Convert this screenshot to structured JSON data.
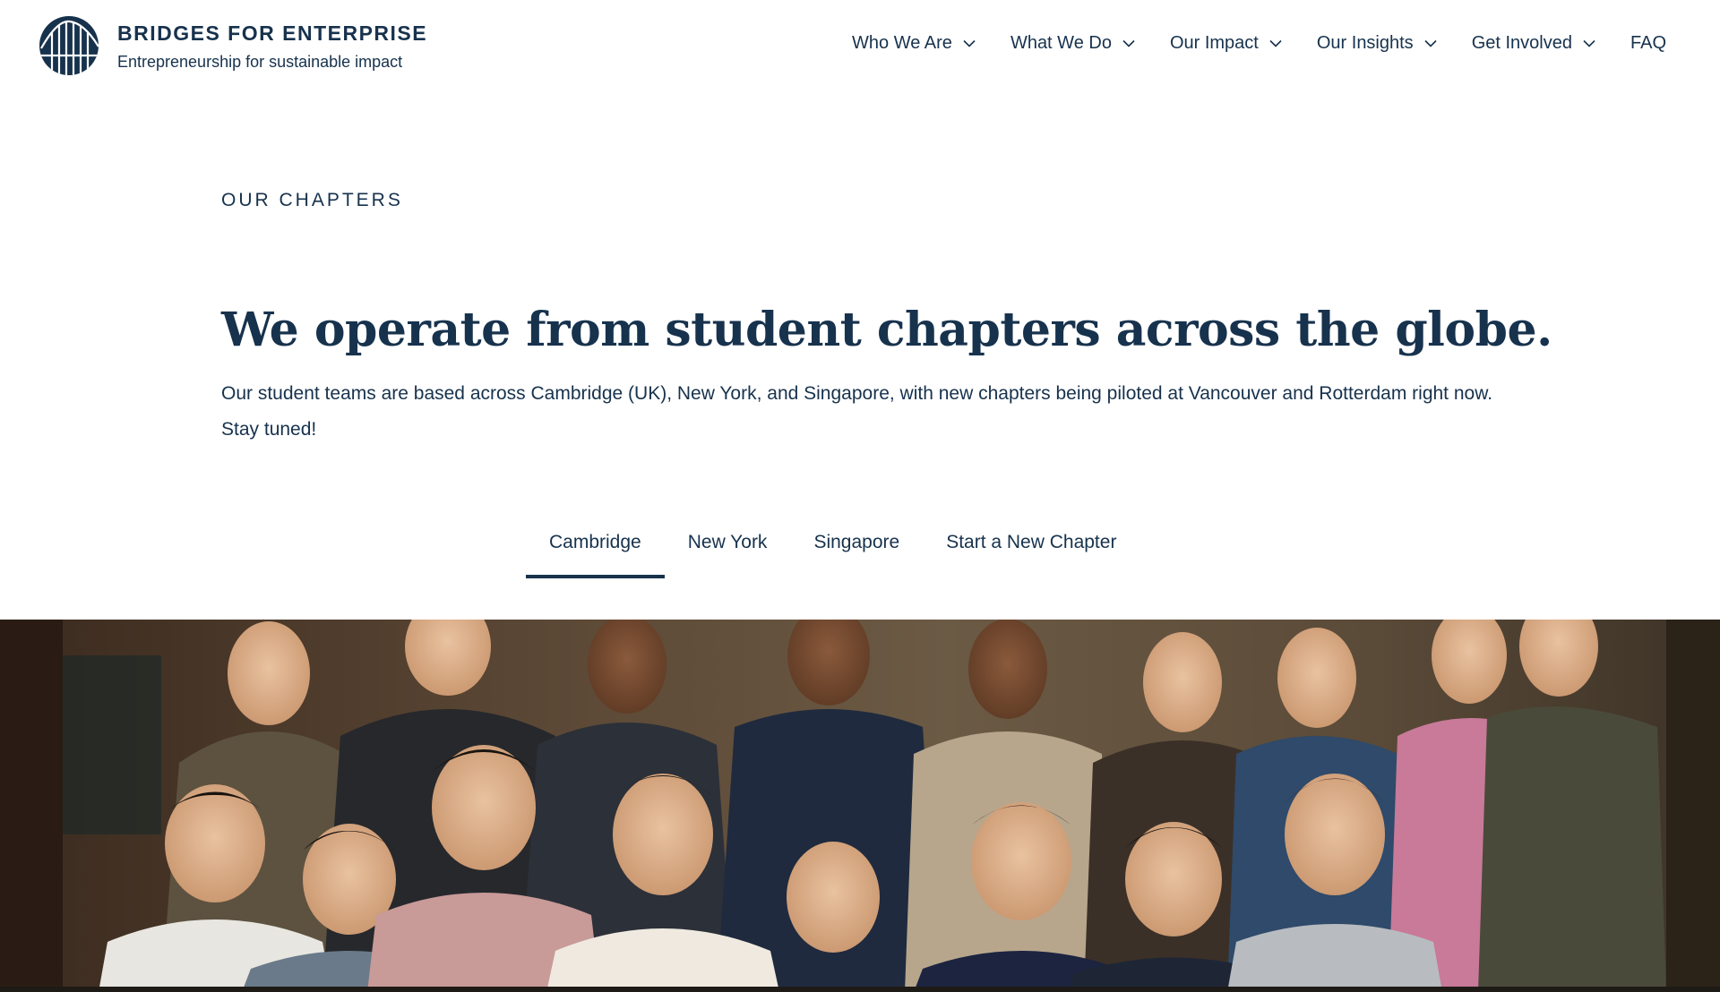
{
  "brand": {
    "title": "BRIDGES FOR ENTERPRISE",
    "tagline": "Entrepreneurship for sustainable impact",
    "logo_icon": "bridge-logo-icon",
    "color": "#17324d"
  },
  "nav": {
    "items": [
      {
        "label": "Who We Are",
        "has_dropdown": true
      },
      {
        "label": "What We Do",
        "has_dropdown": true
      },
      {
        "label": "Our Impact",
        "has_dropdown": true
      },
      {
        "label": "Our Insights",
        "has_dropdown": true
      },
      {
        "label": "Get Involved",
        "has_dropdown": true
      },
      {
        "label": "FAQ",
        "has_dropdown": false
      }
    ]
  },
  "main": {
    "eyebrow": "OUR CHAPTERS",
    "headline": "We operate from student chapters across the globe.",
    "intro": "Our student teams are based across Cambridge (UK), New York, and Singapore, with new chapters being piloted at Vancouver and Rotterdam right now. Stay tuned!",
    "tabs": [
      {
        "label": "Cambridge",
        "active": true
      },
      {
        "label": "New York",
        "active": false
      },
      {
        "label": "Singapore",
        "active": false
      },
      {
        "label": "Start a New Chapter",
        "active": false
      }
    ]
  }
}
